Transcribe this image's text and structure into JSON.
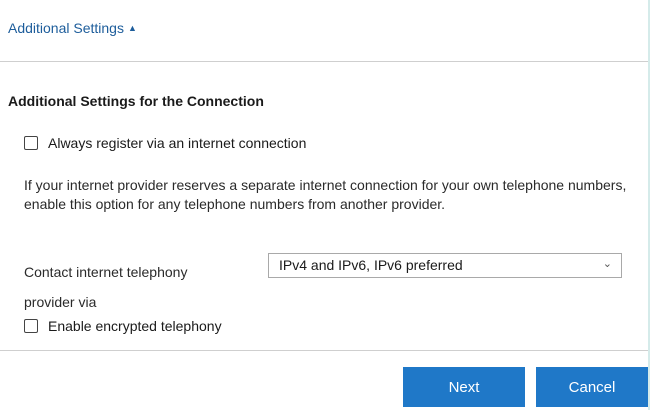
{
  "section_toggle": {
    "label": "Additional Settings",
    "caret": "▲"
  },
  "heading": "Additional Settings for the Connection",
  "options": {
    "always_register": {
      "label": "Always register via an internet connection",
      "checked": false
    },
    "encrypted": {
      "label": "Enable encrypted telephony",
      "checked": false
    }
  },
  "hint": "If your internet provider reserves a separate internet connection for your own telephone numbers, enable this option for any telephone numbers from another provider.",
  "contact": {
    "label": "Contact internet telephony provider via",
    "selected": "IPv4 and IPv6, IPv6 preferred",
    "chevron": "⌄"
  },
  "buttons": {
    "next": "Next",
    "cancel": "Cancel"
  },
  "colors": {
    "accent": "#1f78c8",
    "link": "#1d5d9b",
    "background": "#d5ebea"
  }
}
